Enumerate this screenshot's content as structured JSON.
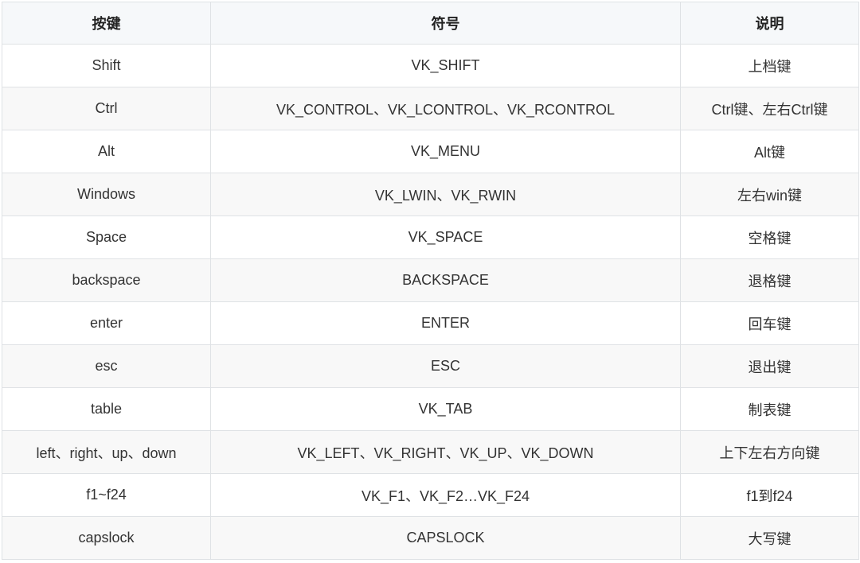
{
  "table": {
    "headers": [
      "按键",
      "符号",
      "说明"
    ],
    "rows": [
      [
        "Shift",
        "VK_SHIFT",
        "上档键"
      ],
      [
        "Ctrl",
        "VK_CONTROL、VK_LCONTROL、VK_RCONTROL",
        "Ctrl键、左右Ctrl键"
      ],
      [
        "Alt",
        "VK_MENU",
        "Alt键"
      ],
      [
        "Windows",
        "VK_LWIN、VK_RWIN",
        "左右win键"
      ],
      [
        "Space",
        "VK_SPACE",
        "空格键"
      ],
      [
        "backspace",
        "BACKSPACE",
        "退格键"
      ],
      [
        "enter",
        "ENTER",
        "回车键"
      ],
      [
        "esc",
        "ESC",
        "退出键"
      ],
      [
        "table",
        "VK_TAB",
        "制表键"
      ],
      [
        "left、right、up、down",
        "VK_LEFT、VK_RIGHT、VK_UP、VK_DOWN",
        "上下左右方向键"
      ],
      [
        "f1~f24",
        "VK_F1、VK_F2…VK_F24",
        "f1到f24"
      ],
      [
        "capslock",
        "CAPSLOCK",
        "大写键"
      ]
    ]
  },
  "colors": {
    "header_bg": "#f6f8fa",
    "row_alt_bg": "#f8f8f8",
    "border": "#dfe2e5",
    "text": "#333333"
  }
}
